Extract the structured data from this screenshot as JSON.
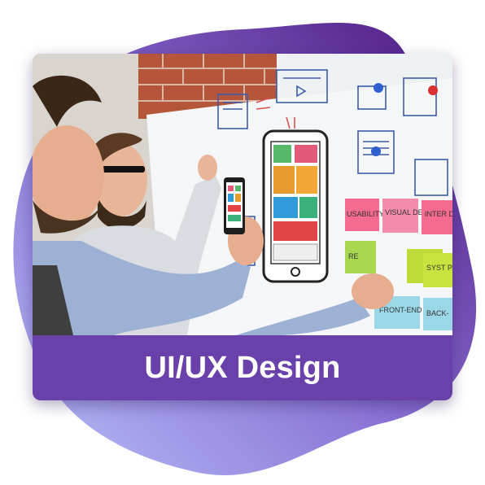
{
  "caption": {
    "title": "UI/UX Design"
  },
  "sticky_notes": {
    "usability": "USABILITY",
    "visual_design": "VISUAL DESIGN",
    "interaction": "INTER DE",
    "research": "RE",
    "system": "SYST PERFOR",
    "frontend": "FRONT-END",
    "backend": "BACK-"
  },
  "colors": {
    "blob_light": "#a9b4f2",
    "blob_dark": "#5a1f8a",
    "caption_bg": "#6a40aa",
    "caption_text": "#ffffff"
  }
}
